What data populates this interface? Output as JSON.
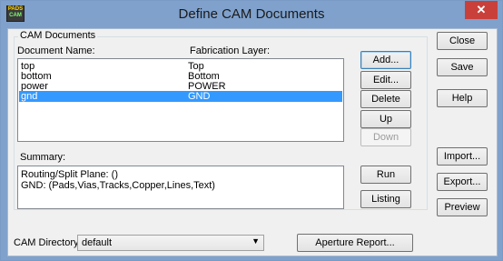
{
  "window": {
    "title": "Define CAM Documents",
    "close_label": "✕",
    "icon_line1": "PADS",
    "icon_line2": "CAM"
  },
  "cam_documents": {
    "group_label": "CAM Documents",
    "col_document_name": "Document Name:",
    "col_fabrication_layer": "Fabrication Layer:",
    "rows": [
      {
        "name": "top",
        "layer": "Top"
      },
      {
        "name": "bottom",
        "layer": "Bottom"
      },
      {
        "name": "power",
        "layer": "POWER"
      },
      {
        "name": "gnd",
        "layer": "GND"
      }
    ],
    "selected_row": 3
  },
  "summary": {
    "label": "Summary:",
    "lines": [
      "Routing/Split Plane: ()",
      "GND: (Pads,Vias,Tracks,Copper,Lines,Text)"
    ]
  },
  "buttons": {
    "add": "Add...",
    "edit": "Edit...",
    "delete": "Delete",
    "up": "Up",
    "down": "Down",
    "run": "Run",
    "listing": "Listing",
    "close": "Close",
    "save": "Save",
    "help": "Help",
    "import": "Import...",
    "export": "Export...",
    "preview": "Preview",
    "aperture_report": "Aperture Report..."
  },
  "cam_directory": {
    "label": "CAM Directory:",
    "value": "default"
  }
}
